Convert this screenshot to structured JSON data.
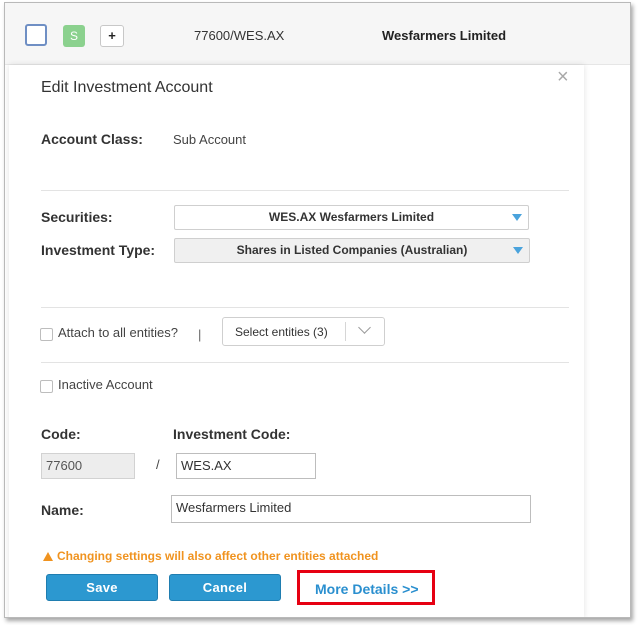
{
  "list_row": {
    "badge_text": "S",
    "plus_label": "+",
    "code": "77600/WES.AX",
    "name": "Wesfarmers Limited"
  },
  "modal": {
    "title": "Edit Investment Account",
    "close_glyph": "×",
    "account_class_label": "Account Class:",
    "account_class_value": "Sub Account",
    "securities_label": "Securities:",
    "securities_value": "WES.AX Wesfarmers Limited",
    "investment_type_label": "Investment Type:",
    "investment_type_value": "Shares in Listed Companies (Australian)",
    "attach_all_label": "Attach to all entities?",
    "separator_glyph": "|",
    "select_entities_label": "Select entities (3)",
    "inactive_label": "Inactive Account",
    "code_label": "Code:",
    "investment_code_label": "Investment Code:",
    "code_value": "77600",
    "slash": "/",
    "investment_code_value": "WES.AX",
    "name_label": "Name:",
    "name_value": "Wesfarmers Limited",
    "warning_text": "Changing settings will also affect other entities attached",
    "save_label": "Save",
    "cancel_label": "Cancel",
    "more_details_label": "More Details >>"
  },
  "colors": {
    "primary_button": "#2c98d0",
    "warning": "#f0931f",
    "highlight_box": "#e60012",
    "link": "#2a8fcf",
    "badge": "#8bd18e"
  }
}
